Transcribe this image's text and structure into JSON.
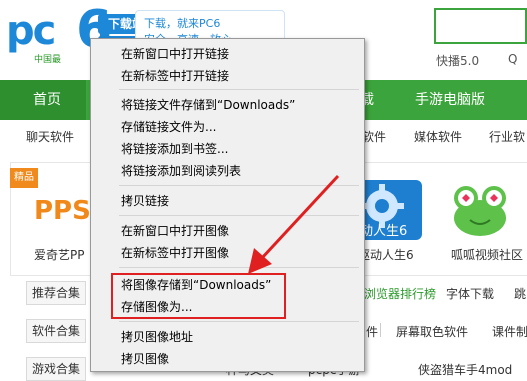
{
  "header": {
    "logo_pc": "pc",
    "logo_6": "6",
    "logo_badge": "下载站",
    "logo_sub": "中国最",
    "slogan_line1": "下载，就来PC6",
    "slogan_line2": "安全、高速、放心",
    "hot_links": [
      "快播5.0",
      "Q"
    ]
  },
  "nav": {
    "items": [
      "首页",
      "载",
      "手游电脑版"
    ]
  },
  "categories": [
    "聊天软件",
    "软件",
    "媒体软件",
    "行业软"
  ],
  "apps": [
    {
      "badge": "精品",
      "logo_text": "PPS",
      "label": "爱奇艺PP"
    },
    {
      "label": "驱动人生6",
      "tile_text": "动人生6"
    },
    {
      "label": "呱呱视频社区"
    }
  ],
  "rows": [
    {
      "tag": "推荐合集",
      "links": [
        "浏览器排行榜",
        "字体下载",
        "跳"
      ]
    },
    {
      "tag": "软件合集",
      "links": [
        "件",
        "屏幕取色软件",
        "课件制"
      ]
    },
    {
      "tag": "游戏合集",
      "links": [
        "种马文美",
        "pcpc手游",
        "侠盗猎车手4mod"
      ]
    }
  ],
  "context_menu": {
    "groups": [
      [
        "在新窗口中打开链接",
        "在新标签中打开链接"
      ],
      [
        "将链接文件存储到“Downloads”",
        "存储链接文件为...",
        "将链接添加到书签...",
        "将链接添加到阅读列表"
      ],
      [
        "拷贝链接"
      ],
      [
        "在新窗口中打开图像",
        "在新标签中打开图像"
      ],
      [
        "将图像存储到“Downloads”",
        "存储图像为..."
      ],
      [
        "拷贝图像地址",
        "拷贝图像"
      ]
    ]
  },
  "colors": {
    "brand_blue": "#1e88d8",
    "nav_green": "#3ca43c",
    "highlight_red": "#e02020",
    "badge_orange": "#f08a1c"
  }
}
